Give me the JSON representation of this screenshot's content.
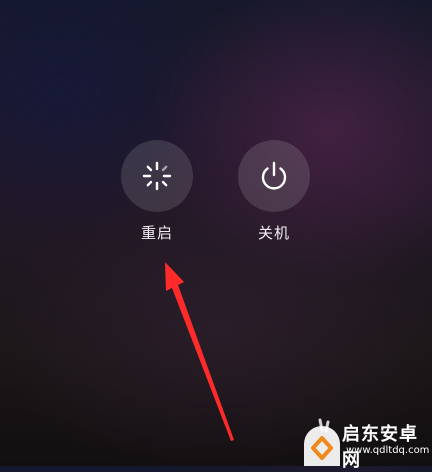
{
  "power_menu": {
    "restart": {
      "label": "重启",
      "icon": "restart-spinner-icon"
    },
    "shutdown": {
      "label": "关机",
      "icon": "power-icon"
    }
  },
  "annotation": {
    "color": "#ff2a2a"
  },
  "watermark": {
    "title": "启东安卓网",
    "url": "www.qdltdq.com"
  }
}
